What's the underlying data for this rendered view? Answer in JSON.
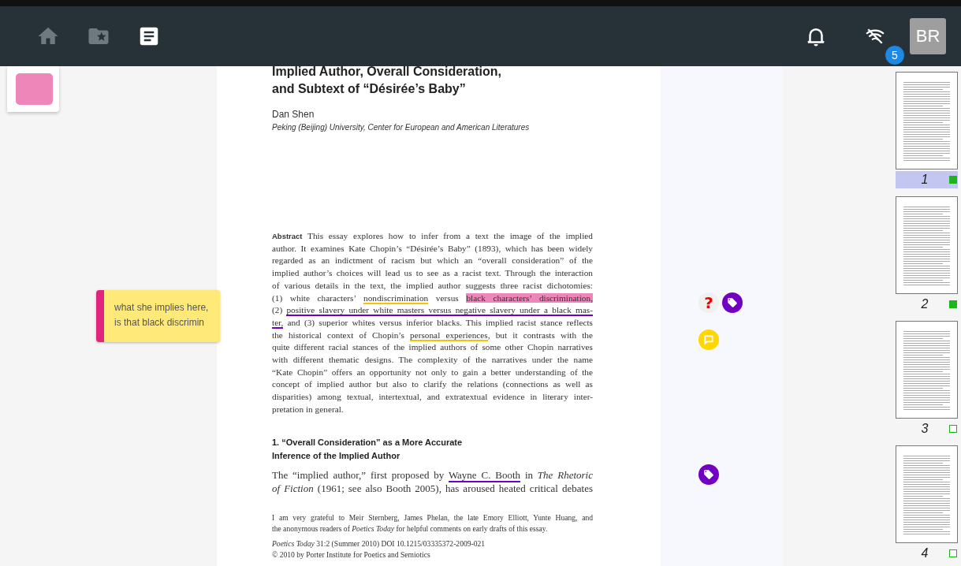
{
  "toolbar": {
    "nav": [
      {
        "kind": "home",
        "selected": false
      },
      {
        "kind": "collection",
        "selected": false
      },
      {
        "kind": "document",
        "selected": true
      }
    ],
    "notification_count": "5",
    "avatar": "BR"
  },
  "left_panel": {
    "swatch": {
      "color": "#ef86b9"
    },
    "note": {
      "text": "what she implies here,\nis that black discrimin",
      "color": "#e0247f"
    }
  },
  "document": {
    "title": [
      "Implied Author, Overall Consideration,",
      "and Subtext of “Désirée’s Baby”"
    ],
    "author": "Dan Shen",
    "affiliation": "Peking (Beijing) University, Center for European and American Literatures",
    "abstract_label": "Abstract",
    "abstract": [
      [
        {
          "text": "This essay explores how to infer from a text the image of the implied"
        }
      ],
      [
        {
          "text": "author. It examines Kate Chopin’s “Désirée’s Baby” (1893), which has been widely"
        }
      ],
      [
        {
          "text": "regarded as an indictment of racism but which an “overall consideration” of the"
        }
      ],
      [
        {
          "text": "implied author’s choices will lead us to see as a racist text. Through the interaction"
        }
      ],
      [
        {
          "text": "of various details in the text, the implied author suggests three racist dichotomies:"
        }
      ],
      [
        {
          "text": "(1) white characters’ "
        },
        {
          "text": "nondiscrimination",
          "kind": "underline",
          "color": "#f5c400"
        },
        {
          "text": " versus "
        },
        {
          "text": "black characters’ discrimination,",
          "kind": "highlight",
          "color": "#ef86b9"
        }
      ],
      [
        {
          "text": "(2) "
        },
        {
          "text": "positive slavery under white masters versus negative slavery under a black mas-",
          "kind": "underline",
          "color": "#7200c2"
        }
      ],
      [
        {
          "text": "ter,",
          "kind": "underline",
          "color": "#7200c2"
        },
        {
          "text": " and (3) superior whites versus inferior blacks. This implied racist stance reflects"
        }
      ],
      [
        {
          "text": "the historical context of Chopin’s "
        },
        {
          "text": "personal experiences",
          "kind": "underline",
          "color": "#f5c400"
        },
        {
          "text": ", but it contrasts with the"
        }
      ],
      [
        {
          "text": "quite different racial stances of the implied authors of some other Chopin narratives"
        }
      ],
      [
        {
          "text": "with different thematic designs. The complexity of the narratives under the name"
        }
      ],
      [
        {
          "text": "“Kate Chopin” offers an opportunity not only to gain a better understanding of the"
        }
      ],
      [
        {
          "text": "concept of implied author but also to clarify the relations (connections as well as"
        }
      ],
      [
        {
          "text": "disparities) among textual, intertextual, and extratextual evidence in literary inter-"
        }
      ],
      [
        {
          "text": "pretation in general."
        }
      ]
    ],
    "section_heading": [
      "1. “Overall Consideration” as a More Accurate",
      "Inference of the Implied Author"
    ],
    "body": [
      [
        {
          "text": "The “implied author,” first proposed by "
        },
        {
          "text": "Wayne C. Booth",
          "kind": "underline",
          "color": "#7200c2"
        },
        {
          "text": " in *The Rhetoric*"
        }
      ],
      [
        {
          "text": "*of Fiction* (1961; see also Booth 2005), has aroused heated critical debates"
        }
      ]
    ],
    "footnote": [
      [
        {
          "text": "I am very grateful to Meir Sternberg, James Phelan, the late Emory Elliott, Yunte Huang, and"
        }
      ],
      [
        {
          "text": "the anonymous readers of *Poetics Today* for helpful comments on early drafts of this essay."
        }
      ]
    ],
    "citation": [
      [
        {
          "text": "*Poetics Today* 31:2 (Summer 2010)   DOI 10.1215/03335372-2009-021"
        }
      ],
      [
        {
          "text": "© 2010 by Porter Institute for Poetics and Semiotics"
        }
      ]
    ]
  },
  "annotations": [
    [
      {
        "kind": "question",
        "color": "#f0f0f0",
        "glyph": "?"
      },
      {
        "kind": "tag",
        "color": "#7200c2"
      }
    ],
    [
      {
        "kind": "comment",
        "color": "#ffd600"
      }
    ],
    [
      {
        "kind": "tag",
        "color": "#7200c2"
      }
    ]
  ],
  "pages": [
    {
      "number": "1",
      "selected": true,
      "done": true
    },
    {
      "number": "2",
      "selected": false,
      "done": true
    },
    {
      "number": "3",
      "selected": false,
      "done": false
    },
    {
      "number": "4",
      "selected": false,
      "done": false
    }
  ]
}
